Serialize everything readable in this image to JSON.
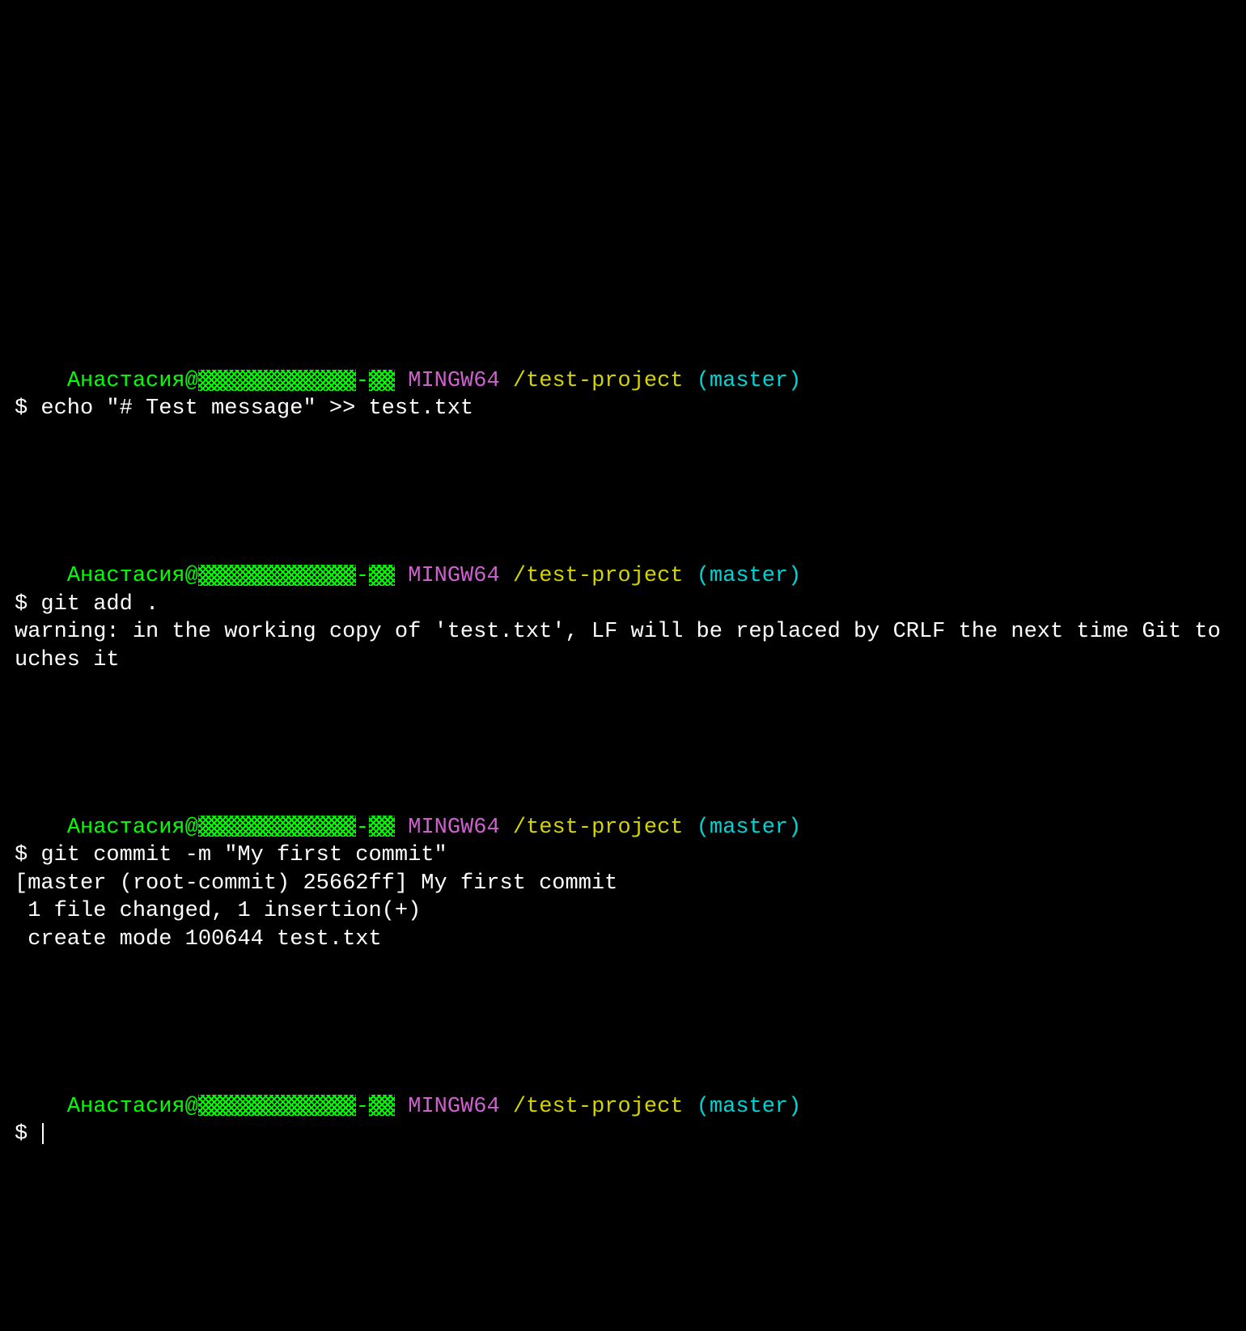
{
  "colors": {
    "user": "#00ff00",
    "mingw": "#d060d0",
    "path": "#d4d400",
    "branch": "#00d4d4",
    "text": "#ffffff",
    "background": "#000000"
  },
  "prompt": {
    "user": "Анастасия",
    "at": "@",
    "dash": "-",
    "shell": "MINGW64",
    "path": "/test-project",
    "branch": "(master)",
    "symbol": "$"
  },
  "blocks": [
    {
      "command": "echo \"# Test message\" >> test.txt",
      "output": []
    },
    {
      "command": "git add .",
      "output": [
        "warning: in the working copy of 'test.txt', LF will be replaced by CRLF the next time Git touches it"
      ]
    },
    {
      "command": "git commit -m \"My first commit\"",
      "output": [
        "[master (root-commit) 25662ff] My first commit",
        " 1 file changed, 1 insertion(+)",
        " create mode 100644 test.txt"
      ]
    },
    {
      "command": "",
      "output": [],
      "cursor": true
    }
  ]
}
